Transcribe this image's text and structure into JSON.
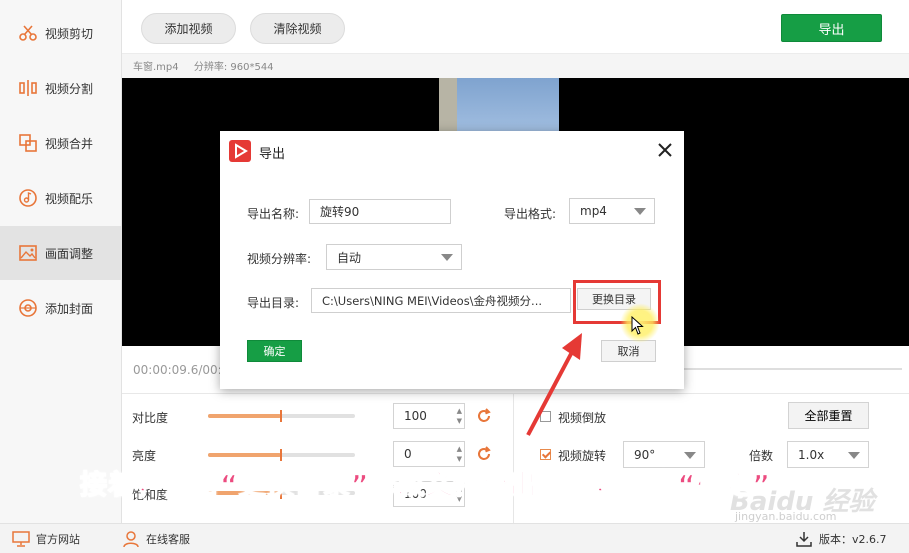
{
  "sidebar": {
    "items": [
      {
        "label": "视频剪切",
        "icon": "scissors-icon"
      },
      {
        "label": "视频分割",
        "icon": "split-icon"
      },
      {
        "label": "视频合并",
        "icon": "merge-icon"
      },
      {
        "label": "视频配乐",
        "icon": "music-icon"
      },
      {
        "label": "画面调整",
        "icon": "image-icon"
      },
      {
        "label": "添加封面",
        "icon": "cover-icon"
      }
    ],
    "active_index": 4
  },
  "toolbar": {
    "add_video": "添加视频",
    "clear_video": "清除视频",
    "export": "导出"
  },
  "file": {
    "name": "车窗.mp4",
    "resolution": "分辨率: 960*544"
  },
  "timeline": {
    "time": "00:00:09.6/00:"
  },
  "controls": {
    "contrast_label": "对比度",
    "contrast_value": "100",
    "brightness_label": "亮度",
    "brightness_value": "0",
    "saturation_label": "饱和度",
    "saturation_value": "100",
    "reverse_label": "视频倒放",
    "rotate_label": "视频旋转",
    "rotate_value": "90°",
    "speed_label": "倍数",
    "speed_value": "1.0x",
    "reset_all": "全部重置"
  },
  "dialog": {
    "title": "导出",
    "name_label": "导出名称:",
    "name_value": "旋转90",
    "format_label": "导出格式:",
    "format_value": "mp4",
    "resolution_label": "视频分辨率:",
    "resolution_value": "自动",
    "dir_label": "导出目录:",
    "dir_value": "C:\\Users\\NING MEI\\Videos\\金舟视频分...",
    "change_dir": "更换目录",
    "confirm": "确定",
    "cancel": "取消"
  },
  "statusbar": {
    "website": "官方网站",
    "service": "在线客服",
    "version": "版本：v2.6.7"
  },
  "overlay": {
    "caption": "接着，点击“更换目录”修改文件导出目录，点击“确定”",
    "watermark": "Baidu 经验",
    "watermark_url": "jingyan.baidu.com"
  },
  "colors": {
    "accent_green": "#169e45",
    "accent_orange": "#e8763a",
    "highlight_red": "#e53935",
    "caption_pink": "#ec4c80"
  }
}
